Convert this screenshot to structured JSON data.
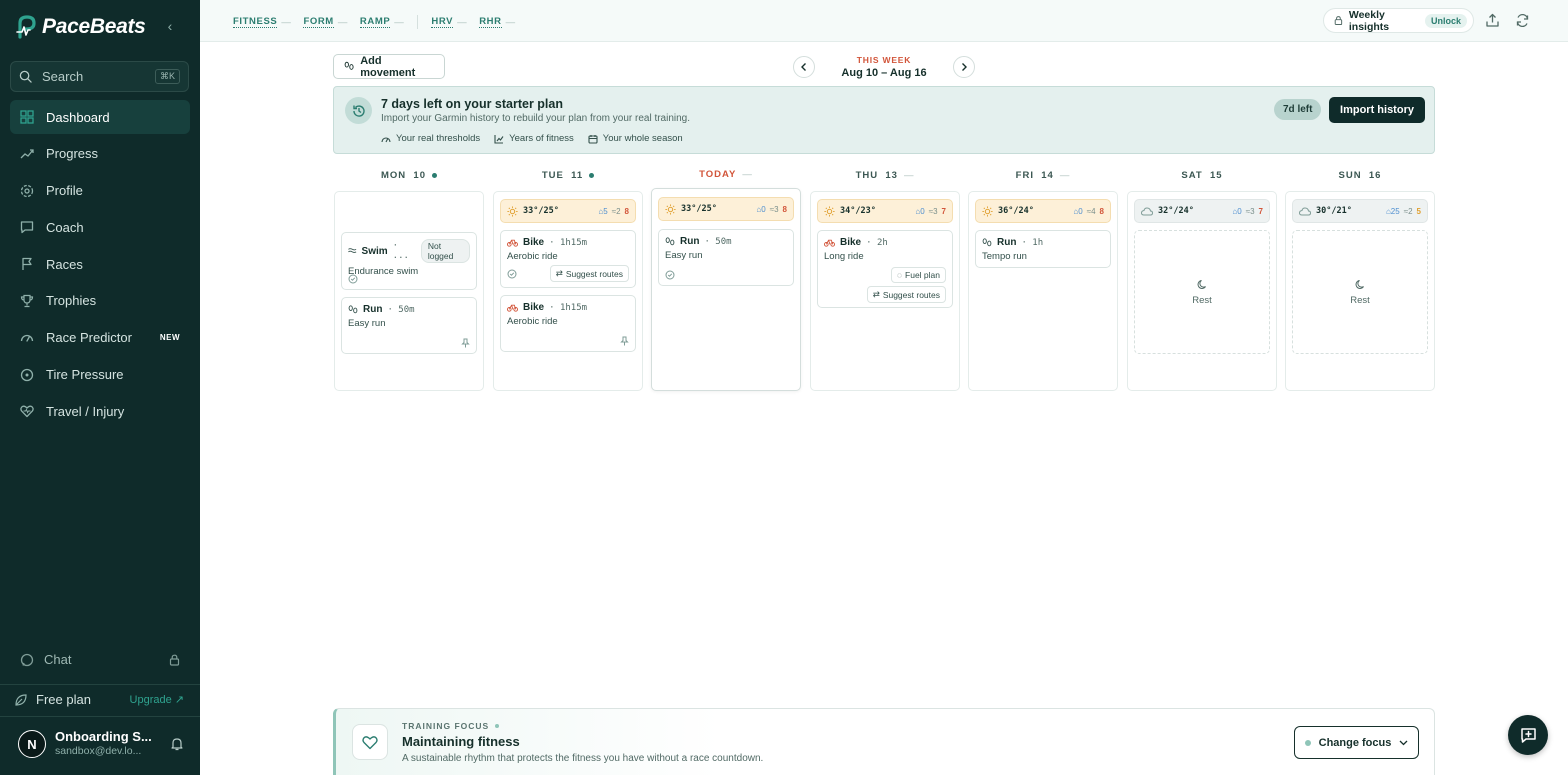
{
  "brand": {
    "name": "PaceBeats",
    "accent": "#2fa38f"
  },
  "sidebar": {
    "search": {
      "label": "Search",
      "shortcut": "⌘K"
    },
    "items": [
      {
        "label": "Dashboard",
        "icon": "grid-icon",
        "active": true
      },
      {
        "label": "Progress",
        "icon": "trend-icon"
      },
      {
        "label": "Profile",
        "icon": "settings-icon"
      },
      {
        "label": "Coach",
        "icon": "message-icon"
      },
      {
        "label": "Races",
        "icon": "flag-icon"
      },
      {
        "label": "Trophies",
        "icon": "trophy-icon"
      },
      {
        "label": "Race Predictor",
        "icon": "gauge-icon",
        "badge": "NEW"
      },
      {
        "label": "Tire Pressure",
        "icon": "tire-icon"
      },
      {
        "label": "Travel / Injury",
        "icon": "heart-icon"
      }
    ],
    "chat": {
      "label": "Chat"
    },
    "plan": {
      "label": "Free plan",
      "upgrade": "Upgrade ↗"
    },
    "user": {
      "initial": "N",
      "name": "Onboarding S...",
      "email": "sandbox@dev.lo..."
    }
  },
  "topbar": {
    "metrics": [
      "FITNESS",
      "FORM",
      "RAMP",
      "HRV",
      "RHR"
    ],
    "metric_dash": "—",
    "insights": {
      "label": "Weekly insights",
      "unlock": "Unlock"
    }
  },
  "week": {
    "add_movement": "Add movement",
    "eyebrow": "THIS WEEK",
    "range": "Aug 10 – Aug 16"
  },
  "banner": {
    "title": "7 days left on your starter plan",
    "subtitle": "Import your Garmin history to rebuild your plan from your real training.",
    "perks": [
      "Your real thresholds",
      "Years of fitness",
      "Your whole season"
    ],
    "days_left": "7d left",
    "import": "Import history"
  },
  "days": [
    {
      "head": "MON  10",
      "marker": "dot"
    },
    {
      "head": "TUE  11",
      "marker": "dot"
    },
    {
      "head": "TODAY",
      "marker": "dash"
    },
    {
      "head": "THU  13",
      "marker": "dash"
    },
    {
      "head": "FRI  14",
      "marker": "dash"
    },
    {
      "head": "SAT  15",
      "marker": "none"
    },
    {
      "head": "SUN  16",
      "marker": "none"
    }
  ],
  "weather": {
    "tue": {
      "temp": "33°/25°",
      "rain": "5",
      "wind": "2",
      "uv": "8"
    },
    "wed": {
      "temp": "33°/25°",
      "rain": "0",
      "wind": "3",
      "uv": "8"
    },
    "thu": {
      "temp": "34°/23°",
      "rain": "0",
      "wind": "3",
      "uv": "7"
    },
    "fri": {
      "temp": "36°/24°",
      "rain": "0",
      "wind": "4",
      "uv": "8"
    },
    "sat": {
      "temp": "32°/24°",
      "rain": "0",
      "wind": "3",
      "uv": "7"
    },
    "sun": {
      "temp": "30°/21°",
      "rain": "25",
      "wind": "2",
      "uv": "5"
    }
  },
  "workouts": {
    "mon_swim": {
      "sport": "Swim",
      "dur": "· ...",
      "tag": "Not logged",
      "desc": "Endurance swim"
    },
    "mon_run": {
      "sport": "Run",
      "dur": "·  50m",
      "desc": "Easy run"
    },
    "tue_bike1": {
      "sport": "Bike",
      "dur": "·  1h15m",
      "desc": "Aerobic ride",
      "action": "Suggest routes"
    },
    "tue_bike2": {
      "sport": "Bike",
      "dur": "·  1h15m",
      "desc": "Aerobic ride"
    },
    "wed_run": {
      "sport": "Run",
      "dur": "·  50m",
      "desc": "Easy run"
    },
    "thu_bike": {
      "sport": "Bike",
      "dur": "·  2h",
      "desc": "Long ride",
      "fuel": "Fuel plan",
      "action": "Suggest routes"
    },
    "fri_run": {
      "sport": "Run",
      "dur": "·  1h",
      "desc": "Tempo run"
    },
    "sat_rest": "Rest",
    "sun_rest": "Rest"
  },
  "focus": {
    "eyebrow": "TRAINING FOCUS",
    "title": "Maintaining fitness",
    "subtitle": "A sustainable rhythm that protects the fitness you have without a race countdown.",
    "change": "Change focus"
  }
}
